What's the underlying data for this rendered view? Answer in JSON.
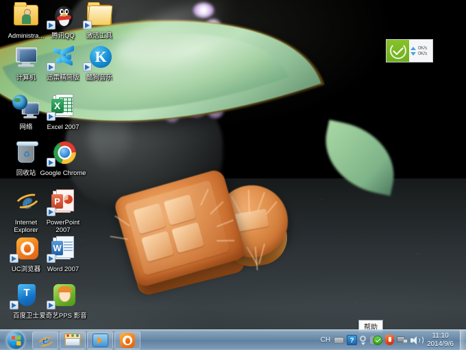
{
  "desktop": {
    "wallpaper_description": "Mooncakes on a green leaf-shaped ceramic dish with a dark teapot and purple flowers",
    "icons": [
      {
        "label": "Administra...",
        "icon": "user-folder-icon",
        "shortcut": false
      },
      {
        "label": "腾讯QQ",
        "icon": "qq-penguin-icon",
        "shortcut": true
      },
      {
        "label": "激活工具",
        "icon": "folder-open-icon",
        "shortcut": true
      },
      {
        "label": "计算机",
        "icon": "computer-icon",
        "shortcut": false
      },
      {
        "label": "迅雷精简版",
        "icon": "thunder-icon",
        "shortcut": true
      },
      {
        "label": "酷狗音乐",
        "icon": "kugou-music-icon",
        "shortcut": true
      },
      {
        "label": "网络",
        "icon": "network-icon",
        "shortcut": false
      },
      {
        "label": "Excel 2007",
        "icon": "excel-icon",
        "shortcut": true
      },
      {
        "label": "回收站",
        "icon": "recycle-bin-icon",
        "shortcut": false
      },
      {
        "label": "Google Chrome",
        "icon": "chrome-icon",
        "shortcut": true
      },
      {
        "label": "Internet Explorer",
        "icon": "internet-explorer-icon",
        "shortcut": false
      },
      {
        "label": "PowerPoint 2007",
        "icon": "powerpoint-icon",
        "shortcut": true
      },
      {
        "label": "UC浏览器",
        "icon": "uc-browser-icon",
        "shortcut": true
      },
      {
        "label": "Word 2007",
        "icon": "word-icon",
        "shortcut": true
      },
      {
        "label": "百度卫士",
        "icon": "baidu-guard-shield-icon",
        "shortcut": true
      },
      {
        "label": "爱奇艺PPS 影音",
        "icon": "iqiyi-pps-icon",
        "shortcut": true
      }
    ]
  },
  "net_widget": {
    "status_icon": "green-check-icon",
    "upload_speed": "0K/s",
    "download_speed": "0K/s"
  },
  "tooltip": {
    "text": "帮助"
  },
  "taskbar": {
    "start_button_label": "Start",
    "quick_launch": [
      {
        "name": "internet-explorer",
        "glyph": "e"
      },
      {
        "name": "file-explorer",
        "glyph": ""
      },
      {
        "name": "windows-media-player",
        "glyph": ""
      },
      {
        "name": "uc-browser",
        "glyph": ""
      }
    ],
    "tray": {
      "ime_language": "CH",
      "ime_keyboard": "keyboard-icon",
      "ime_help": "?",
      "items": [
        "settings-gear-icon",
        "network-ok-icon",
        "security-shield-icon",
        "network-connection-icon",
        "volume-icon"
      ]
    },
    "clock": {
      "time": "11:10",
      "date": "2014/9/6"
    },
    "show_desktop_label": "Show desktop"
  },
  "colors": {
    "accent_green": "#7bb81f",
    "taskbar_blue": "#6d8fb0",
    "dish_green": "#a9d8a4",
    "mooncake_orange": "#df8a46"
  }
}
